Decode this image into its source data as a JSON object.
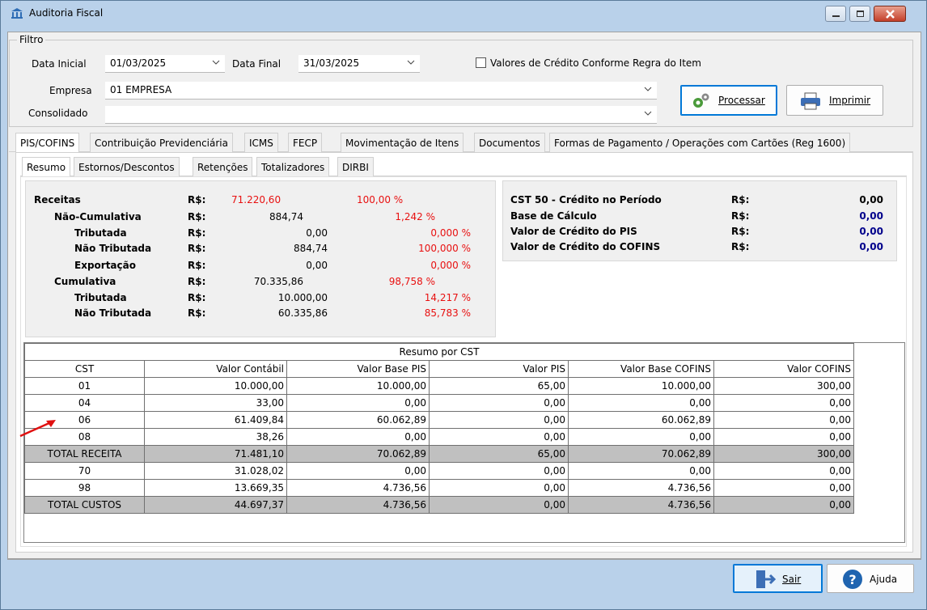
{
  "window": {
    "title": "Auditoria Fiscal"
  },
  "filter": {
    "legend": "Filtro",
    "data_inicial_label": "Data Inicial",
    "data_inicial": "01/03/2025",
    "data_final_label": "Data Final",
    "data_final": "31/03/2025",
    "credito_checkbox_label": "Valores de Crédito Conforme Regra do Item",
    "credito_checked": false,
    "empresa_label": "Empresa",
    "empresa": "01 EMPRESA",
    "consolidado_label": "Consolidado",
    "consolidado": "",
    "processar": "Processar",
    "imprimir": "Imprimir"
  },
  "main_tabs": [
    "PIS/COFINS",
    "Contribuição Previdenciária",
    "ICMS",
    "FECP",
    "Movimentação de Itens",
    "Documentos",
    "Formas de Pagamento / Operações com Cartões  (Reg 1600)"
  ],
  "sub_tabs": [
    "Resumo",
    "Estornos/Descontos",
    "Retenções",
    "Totalizadores",
    "DIRBI"
  ],
  "summary": [
    {
      "label": "Receitas",
      "cur": "R$:",
      "value": "71.220,60",
      "pct": "100,00 %"
    },
    {
      "label": "Não-Cumulativa",
      "cur": "R$:",
      "value": "884,74",
      "pct": "1,242 %"
    },
    {
      "label": "Tributada",
      "cur": "R$:",
      "value": "0,00",
      "pct": "0,000 %"
    },
    {
      "label": "Não Tributada",
      "cur": "R$:",
      "value": "884,74",
      "pct": "100,000 %"
    },
    {
      "label": "Exportação",
      "cur": "R$:",
      "value": "0,00",
      "pct": "0,000 %"
    },
    {
      "label": "Cumulativa",
      "cur": "R$:",
      "value": "70.335,86",
      "pct": "98,758 %"
    },
    {
      "label": "Tributada",
      "cur": "R$:",
      "value": "10.000,00",
      "pct": "14,217 %"
    },
    {
      "label": "Não Tributada",
      "cur": "R$:",
      "value": "60.335,86",
      "pct": "85,783 %"
    }
  ],
  "credit": [
    {
      "label": "CST 50 - Crédito no Período",
      "cur": "R$:",
      "value": "0,00"
    },
    {
      "label": "Base de Cálculo",
      "cur": "R$:",
      "value": "0,00"
    },
    {
      "label": "Valor de Crédito do PIS",
      "cur": "R$:",
      "value": "0,00"
    },
    {
      "label": "Valor de Crédito do COFINS",
      "cur": "R$:",
      "value": "0,00"
    }
  ],
  "grid": {
    "title": "Resumo por CST",
    "columns": [
      "CST",
      "Valor Contábil",
      "Valor Base PIS",
      "Valor PIS",
      "Valor Base COFINS",
      "Valor COFINS"
    ],
    "rows": [
      [
        "01",
        "10.000,00",
        "10.000,00",
        "65,00",
        "10.000,00",
        "300,00"
      ],
      [
        "04",
        "33,00",
        "0,00",
        "0,00",
        "0,00",
        "0,00"
      ],
      [
        "06",
        "61.409,84",
        "60.062,89",
        "0,00",
        "60.062,89",
        "0,00"
      ],
      [
        "08",
        "38,26",
        "0,00",
        "0,00",
        "0,00",
        "0,00"
      ],
      [
        "TOTAL RECEITA",
        "71.481,10",
        "70.062,89",
        "65,00",
        "70.062,89",
        "300,00"
      ],
      [
        "70",
        "31.028,02",
        "0,00",
        "0,00",
        "0,00",
        "0,00"
      ],
      [
        "98",
        "13.669,35",
        "4.736,56",
        "0,00",
        "4.736,56",
        "0,00"
      ],
      [
        "TOTAL CUSTOS",
        "44.697,37",
        "4.736,56",
        "0,00",
        "4.736,56",
        "0,00"
      ]
    ]
  },
  "footer": {
    "sair": "Sair",
    "ajuda": "Ajuda"
  }
}
